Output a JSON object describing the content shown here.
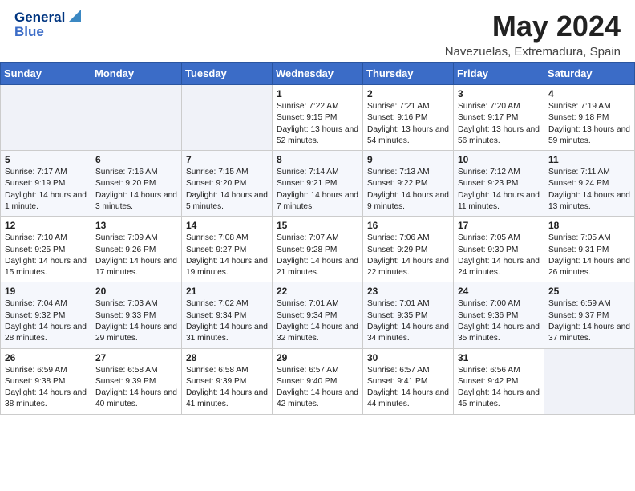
{
  "header": {
    "logo_line1": "General",
    "logo_line2": "Blue",
    "month_title": "May 2024",
    "location": "Navezuelas, Extremadura, Spain"
  },
  "days_of_week": [
    "Sunday",
    "Monday",
    "Tuesday",
    "Wednesday",
    "Thursday",
    "Friday",
    "Saturday"
  ],
  "weeks": [
    [
      {
        "day": "",
        "content": ""
      },
      {
        "day": "",
        "content": ""
      },
      {
        "day": "",
        "content": ""
      },
      {
        "day": "1",
        "content": "Sunrise: 7:22 AM\nSunset: 9:15 PM\nDaylight: 13 hours and 52 minutes."
      },
      {
        "day": "2",
        "content": "Sunrise: 7:21 AM\nSunset: 9:16 PM\nDaylight: 13 hours and 54 minutes."
      },
      {
        "day": "3",
        "content": "Sunrise: 7:20 AM\nSunset: 9:17 PM\nDaylight: 13 hours and 56 minutes."
      },
      {
        "day": "4",
        "content": "Sunrise: 7:19 AM\nSunset: 9:18 PM\nDaylight: 13 hours and 59 minutes."
      }
    ],
    [
      {
        "day": "5",
        "content": "Sunrise: 7:17 AM\nSunset: 9:19 PM\nDaylight: 14 hours and 1 minute."
      },
      {
        "day": "6",
        "content": "Sunrise: 7:16 AM\nSunset: 9:20 PM\nDaylight: 14 hours and 3 minutes."
      },
      {
        "day": "7",
        "content": "Sunrise: 7:15 AM\nSunset: 9:20 PM\nDaylight: 14 hours and 5 minutes."
      },
      {
        "day": "8",
        "content": "Sunrise: 7:14 AM\nSunset: 9:21 PM\nDaylight: 14 hours and 7 minutes."
      },
      {
        "day": "9",
        "content": "Sunrise: 7:13 AM\nSunset: 9:22 PM\nDaylight: 14 hours and 9 minutes."
      },
      {
        "day": "10",
        "content": "Sunrise: 7:12 AM\nSunset: 9:23 PM\nDaylight: 14 hours and 11 minutes."
      },
      {
        "day": "11",
        "content": "Sunrise: 7:11 AM\nSunset: 9:24 PM\nDaylight: 14 hours and 13 minutes."
      }
    ],
    [
      {
        "day": "12",
        "content": "Sunrise: 7:10 AM\nSunset: 9:25 PM\nDaylight: 14 hours and 15 minutes."
      },
      {
        "day": "13",
        "content": "Sunrise: 7:09 AM\nSunset: 9:26 PM\nDaylight: 14 hours and 17 minutes."
      },
      {
        "day": "14",
        "content": "Sunrise: 7:08 AM\nSunset: 9:27 PM\nDaylight: 14 hours and 19 minutes."
      },
      {
        "day": "15",
        "content": "Sunrise: 7:07 AM\nSunset: 9:28 PM\nDaylight: 14 hours and 21 minutes."
      },
      {
        "day": "16",
        "content": "Sunrise: 7:06 AM\nSunset: 9:29 PM\nDaylight: 14 hours and 22 minutes."
      },
      {
        "day": "17",
        "content": "Sunrise: 7:05 AM\nSunset: 9:30 PM\nDaylight: 14 hours and 24 minutes."
      },
      {
        "day": "18",
        "content": "Sunrise: 7:05 AM\nSunset: 9:31 PM\nDaylight: 14 hours and 26 minutes."
      }
    ],
    [
      {
        "day": "19",
        "content": "Sunrise: 7:04 AM\nSunset: 9:32 PM\nDaylight: 14 hours and 28 minutes."
      },
      {
        "day": "20",
        "content": "Sunrise: 7:03 AM\nSunset: 9:33 PM\nDaylight: 14 hours and 29 minutes."
      },
      {
        "day": "21",
        "content": "Sunrise: 7:02 AM\nSunset: 9:34 PM\nDaylight: 14 hours and 31 minutes."
      },
      {
        "day": "22",
        "content": "Sunrise: 7:01 AM\nSunset: 9:34 PM\nDaylight: 14 hours and 32 minutes."
      },
      {
        "day": "23",
        "content": "Sunrise: 7:01 AM\nSunset: 9:35 PM\nDaylight: 14 hours and 34 minutes."
      },
      {
        "day": "24",
        "content": "Sunrise: 7:00 AM\nSunset: 9:36 PM\nDaylight: 14 hours and 35 minutes."
      },
      {
        "day": "25",
        "content": "Sunrise: 6:59 AM\nSunset: 9:37 PM\nDaylight: 14 hours and 37 minutes."
      }
    ],
    [
      {
        "day": "26",
        "content": "Sunrise: 6:59 AM\nSunset: 9:38 PM\nDaylight: 14 hours and 38 minutes."
      },
      {
        "day": "27",
        "content": "Sunrise: 6:58 AM\nSunset: 9:39 PM\nDaylight: 14 hours and 40 minutes."
      },
      {
        "day": "28",
        "content": "Sunrise: 6:58 AM\nSunset: 9:39 PM\nDaylight: 14 hours and 41 minutes."
      },
      {
        "day": "29",
        "content": "Sunrise: 6:57 AM\nSunset: 9:40 PM\nDaylight: 14 hours and 42 minutes."
      },
      {
        "day": "30",
        "content": "Sunrise: 6:57 AM\nSunset: 9:41 PM\nDaylight: 14 hours and 44 minutes."
      },
      {
        "day": "31",
        "content": "Sunrise: 6:56 AM\nSunset: 9:42 PM\nDaylight: 14 hours and 45 minutes."
      },
      {
        "day": "",
        "content": ""
      }
    ]
  ]
}
